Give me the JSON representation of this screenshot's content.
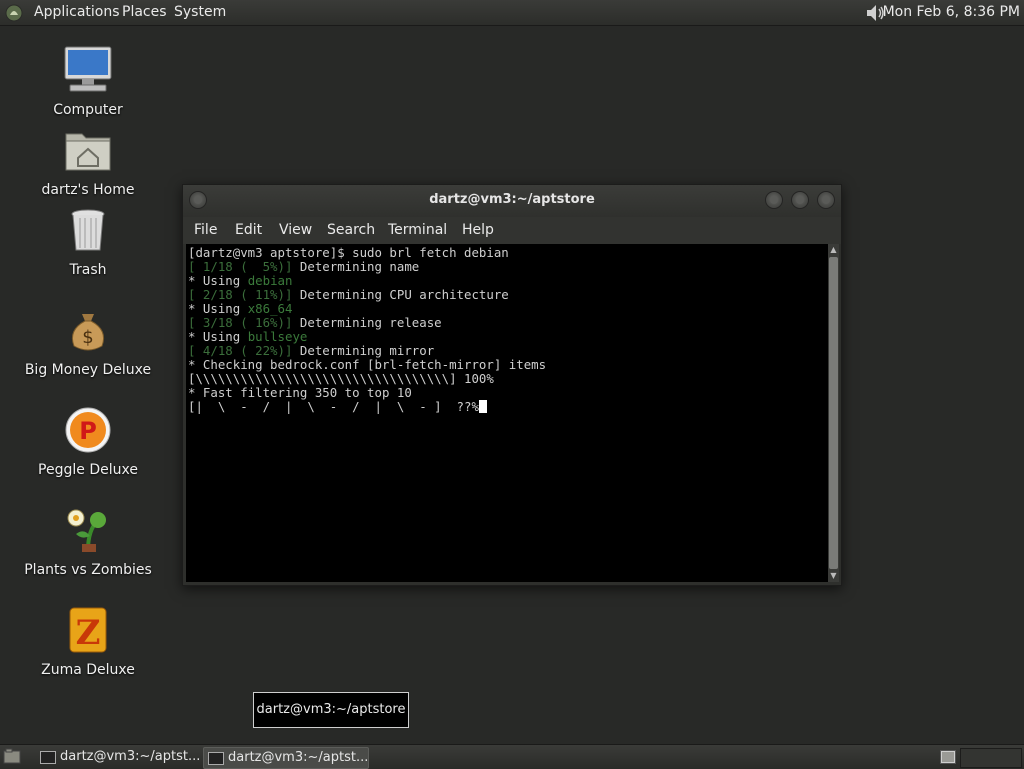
{
  "top_panel": {
    "menu": [
      "Applications",
      "Places",
      "System"
    ],
    "clock": "Mon Feb  6,  8:36 PM",
    "icons": {
      "apps": "gnome-foot-icon",
      "volume": "speaker-icon"
    }
  },
  "desktop_icons": [
    {
      "label": "Computer",
      "icon": "monitor-icon"
    },
    {
      "label": "dartz's Home",
      "icon": "home-folder-icon"
    },
    {
      "label": "Trash",
      "icon": "trash-icon"
    },
    {
      "label": "Big Money Deluxe",
      "icon": "money-bag-icon"
    },
    {
      "label": "Peggle Deluxe",
      "icon": "peggle-icon"
    },
    {
      "label": "Plants vs Zombies",
      "icon": "plants-icon"
    },
    {
      "label": "Zuma Deluxe",
      "icon": "zuma-icon"
    }
  ],
  "terminal": {
    "title": "dartz@vm3:~/aptstore",
    "menu": [
      "File",
      "Edit",
      "View",
      "Search",
      "Terminal",
      "Help"
    ],
    "lines": [
      {
        "parts": [
          {
            "t": "[dartz@vm3 aptstore]$ sudo brl fetch debian",
            "c": ""
          }
        ]
      },
      {
        "parts": [
          {
            "t": "[ 1/18 (  5%)]",
            "c": "dim"
          },
          {
            "t": " Determining name",
            "c": ""
          }
        ]
      },
      {
        "parts": [
          {
            "t": "* Using ",
            "c": ""
          },
          {
            "t": "debian",
            "c": "dimv"
          }
        ]
      },
      {
        "parts": [
          {
            "t": "[ 2/18 ( 11%)]",
            "c": "dim"
          },
          {
            "t": " Determining CPU architecture",
            "c": ""
          }
        ]
      },
      {
        "parts": [
          {
            "t": "* Using ",
            "c": ""
          },
          {
            "t": "x86_64",
            "c": "dimv"
          }
        ]
      },
      {
        "parts": [
          {
            "t": "[ 3/18 ( 16%)]",
            "c": "dim"
          },
          {
            "t": " Determining release",
            "c": ""
          }
        ]
      },
      {
        "parts": [
          {
            "t": "* Using ",
            "c": ""
          },
          {
            "t": "bullseye",
            "c": "dimv"
          }
        ]
      },
      {
        "parts": [
          {
            "t": "[ 4/18 ( 22%)]",
            "c": "dim"
          },
          {
            "t": " Determining mirror",
            "c": ""
          }
        ]
      },
      {
        "parts": [
          {
            "t": "* Checking bedrock.conf [brl-fetch-mirror] items",
            "c": ""
          }
        ]
      },
      {
        "parts": [
          {
            "t": "[\\\\\\\\\\\\\\\\\\\\\\\\\\\\\\\\\\\\\\\\\\\\\\\\\\\\\\\\\\\\\\\\\\\\] 100%",
            "c": ""
          }
        ]
      },
      {
        "parts": [
          {
            "t": "* Fast filtering 350 to top 10",
            "c": ""
          }
        ]
      },
      {
        "parts": [
          {
            "t": "[|  \\  -  /  |  \\  -  /  |  \\  - ]  ??%",
            "c": ""
          }
        ],
        "cursor": true
      }
    ]
  },
  "tooltip": "dartz@vm3:~/aptstore",
  "taskbar": {
    "tasks": [
      {
        "label": "dartz@vm3:~/aptst..."
      },
      {
        "label": "dartz@vm3:~/aptst..."
      }
    ],
    "icons": {
      "show_desktop": "show-desktop-icon",
      "workspace": "workspace-switcher-icon"
    }
  },
  "colors": {
    "desktop": "#282927",
    "terminal_bg": "#000000",
    "dim_green": "#3b6e3b"
  }
}
